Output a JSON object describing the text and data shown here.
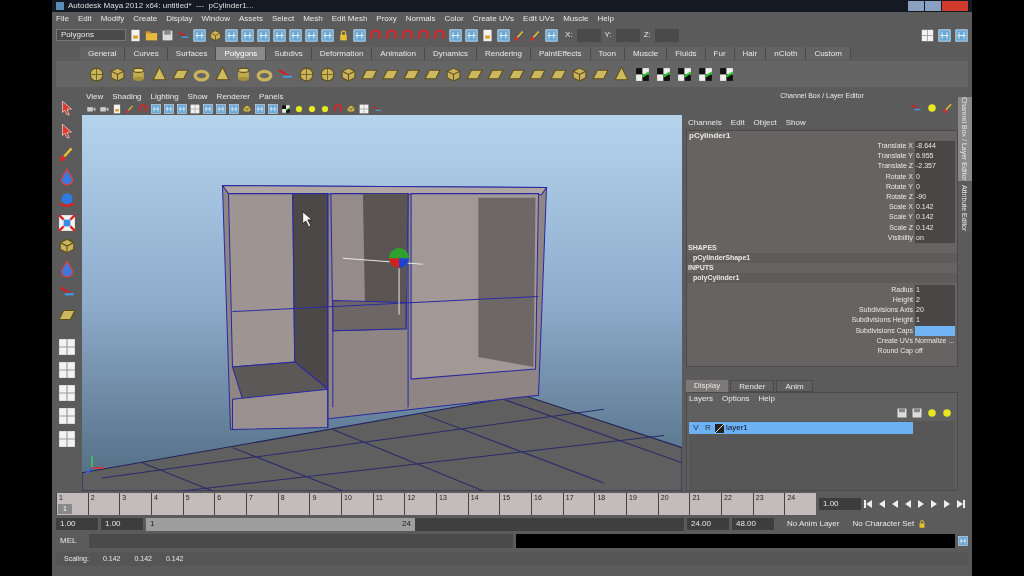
{
  "window": {
    "title": "Autodesk Maya 2012 x64: untitled*  ---  pCylinder1..."
  },
  "menu_bar": [
    "File",
    "Edit",
    "Modify",
    "Create",
    "Display",
    "Window",
    "Assets",
    "Select",
    "Mesh",
    "Edit Mesh",
    "Proxy",
    "Normals",
    "Color",
    "Create UVs",
    "Edit UVs",
    "Muscle",
    "Help"
  ],
  "status_line": {
    "mode": "Polygons",
    "coordinates": [
      {
        "label": "X:"
      },
      {
        "label": "Y:"
      },
      {
        "label": "Z:"
      }
    ]
  },
  "shelf_tabs": [
    {
      "label": "General",
      "selected": false
    },
    {
      "label": "Curves",
      "selected": false
    },
    {
      "label": "Surfaces",
      "selected": false
    },
    {
      "label": "Polygons",
      "selected": true
    },
    {
      "label": "Subdivs",
      "selected": false
    },
    {
      "label": "Deformation",
      "selected": false
    },
    {
      "label": "Animation",
      "selected": false
    },
    {
      "label": "Dynamics",
      "selected": false
    },
    {
      "label": "Rendering",
      "selected": false
    },
    {
      "label": "PaintEffects",
      "selected": false
    },
    {
      "label": "Toon",
      "selected": false
    },
    {
      "label": "Muscle",
      "selected": false
    },
    {
      "label": "Fluids",
      "selected": false
    },
    {
      "label": "Fur",
      "selected": false
    },
    {
      "label": "Hair",
      "selected": false
    },
    {
      "label": "nCloth",
      "selected": false
    },
    {
      "label": "Custom",
      "selected": false
    }
  ],
  "viewport": {
    "menu": [
      "View",
      "Shading",
      "Lighting",
      "Show",
      "Renderer",
      "Panels"
    ]
  },
  "channel_box": {
    "title": "Channel Box / Layer Editor",
    "menu": [
      "Channels",
      "Edit",
      "Object",
      "Show"
    ],
    "object": "pCylinder1",
    "attributes": [
      {
        "label": "Translate X",
        "value": "-8.644"
      },
      {
        "label": "Translate Y",
        "value": "6.955"
      },
      {
        "label": "Translate Z",
        "value": "-2.357"
      },
      {
        "label": "Rotate X",
        "value": "0"
      },
      {
        "label": "Rotate Y",
        "value": "0"
      },
      {
        "label": "Rotate Z",
        "value": "-90"
      },
      {
        "label": "Scale X",
        "value": "0.142"
      },
      {
        "label": "Scale Y",
        "value": "0.142"
      },
      {
        "label": "Scale Z",
        "value": "0.142"
      },
      {
        "label": "Visibility",
        "value": "on"
      }
    ],
    "shapes_heading": "SHAPES",
    "shape": "pCylinderShape1",
    "inputs_heading": "INPUTS",
    "input": "polyCylinder1",
    "input_attributes": [
      {
        "kind": "field",
        "label": "Radius",
        "value": "1",
        "selected": false
      },
      {
        "kind": "field",
        "label": "Height",
        "value": "2",
        "selected": false
      },
      {
        "kind": "field",
        "label": "Subdivisions Axis",
        "value": "20",
        "selected": false
      },
      {
        "kind": "field",
        "label": "Subdivisions Height",
        "value": "1",
        "selected": false
      },
      {
        "kind": "field",
        "label": "Subdivisions Caps",
        "selected": true
      },
      {
        "kind": "plain",
        "label": "Create UVs",
        "value": "Normalize ..."
      },
      {
        "kind": "plain",
        "label": "Round Cap",
        "value": "off"
      }
    ]
  },
  "layer_editor": {
    "tabs": [
      {
        "label": "Display",
        "selected": true
      },
      {
        "label": "Render",
        "selected": false
      },
      {
        "label": "Anim",
        "selected": false
      }
    ],
    "menu": [
      "Layers",
      "Options",
      "Help"
    ],
    "layers": [
      {
        "visible_label": "V",
        "render_label": "R",
        "name": "layer1",
        "selected": true
      }
    ]
  },
  "side_tabs": [
    {
      "label": "Channel Box / Layer Editor",
      "selected": true
    },
    {
      "label": "Attribute Editor",
      "selected": false
    }
  ],
  "time_slider": {
    "frames": [
      "1",
      "2",
      "3",
      "4",
      "5",
      "6",
      "7",
      "8",
      "9",
      "10",
      "11",
      "12",
      "13",
      "14",
      "15",
      "16",
      "17",
      "18",
      "19",
      "20",
      "21",
      "22",
      "23",
      "24"
    ],
    "current_frame": "1",
    "level": 0,
    "current_time": "1.00"
  },
  "range_slider": {
    "start_time": "1.00",
    "playback_start": "1.00",
    "range_start": "1",
    "range_end": "24",
    "level": 0.5,
    "playback_end": "24.00",
    "end_time": "48.00",
    "anim_layer": "No Anim Layer",
    "character_set": "No Character Set"
  },
  "command_line": {
    "label": "MEL"
  },
  "help_line": {
    "label": "Scaling:",
    "values": [
      "0.142",
      "0.142",
      "0.142"
    ]
  }
}
